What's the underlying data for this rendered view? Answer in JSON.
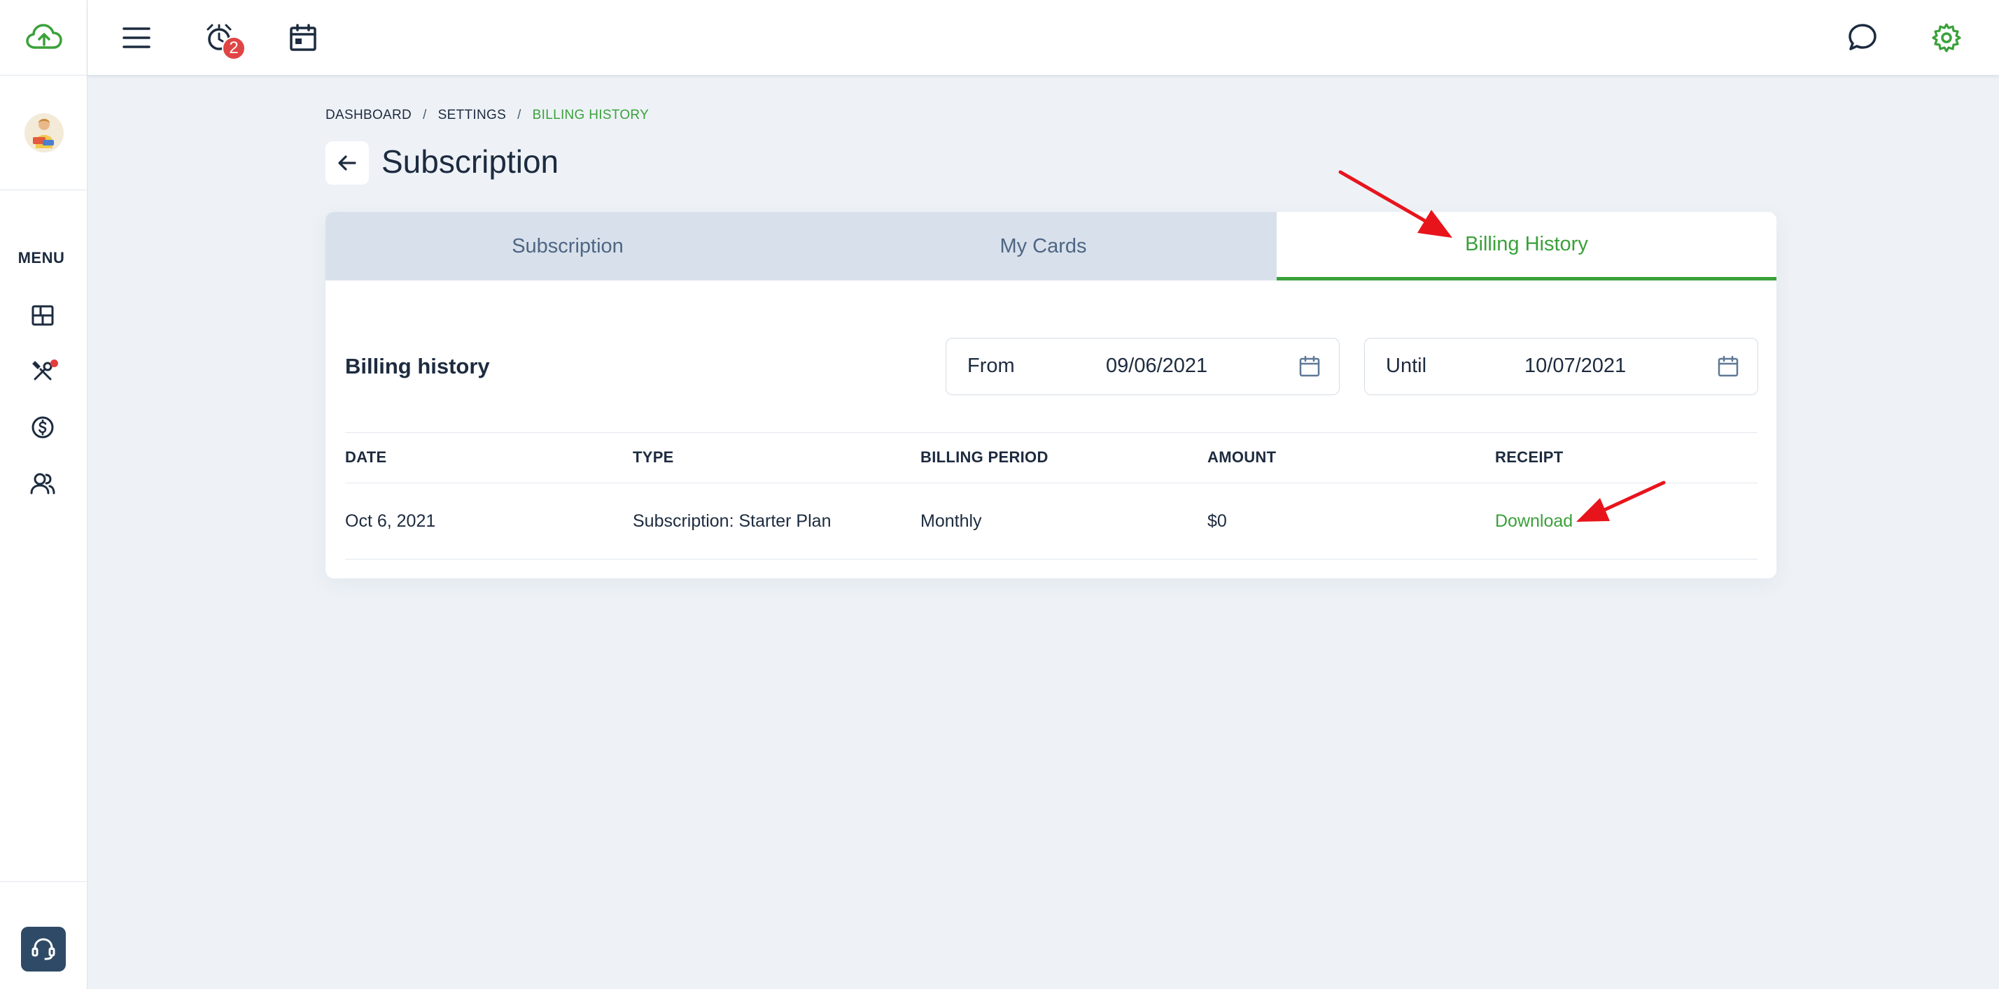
{
  "sidebar": {
    "menu_label": "MENU",
    "icons": [
      "cloud-upload-icon",
      "dashboard-icon",
      "tools-icon",
      "dollar-icon",
      "users-icon",
      "support-headset-icon"
    ]
  },
  "topbar": {
    "notification_count": "2"
  },
  "breadcrumb": {
    "items": [
      "DASHBOARD",
      "SETTINGS",
      "BILLING HISTORY"
    ],
    "separator": "/"
  },
  "page": {
    "title": "Subscription"
  },
  "tabs": [
    {
      "label": "Subscription",
      "active": false
    },
    {
      "label": "My Cards",
      "active": false
    },
    {
      "label": "Billing History",
      "active": true
    }
  ],
  "billing": {
    "title": "Billing history",
    "from_label": "From",
    "from_value": "09/06/2021",
    "until_label": "Until",
    "until_value": "10/07/2021",
    "columns": [
      "DATE",
      "TYPE",
      "BILLING PERIOD",
      "AMOUNT",
      "RECEIPT"
    ],
    "rows": [
      {
        "date": "Oct 6, 2021",
        "type": "Subscription: Starter Plan",
        "period": "Monthly",
        "amount": "$0",
        "receipt": "Download"
      }
    ]
  },
  "colors": {
    "accent_green": "#3aa13a",
    "navy": "#1d2b3f",
    "badge_red": "#e04545",
    "annotation_red": "#e8141c",
    "page_bg": "#eef2f7"
  }
}
